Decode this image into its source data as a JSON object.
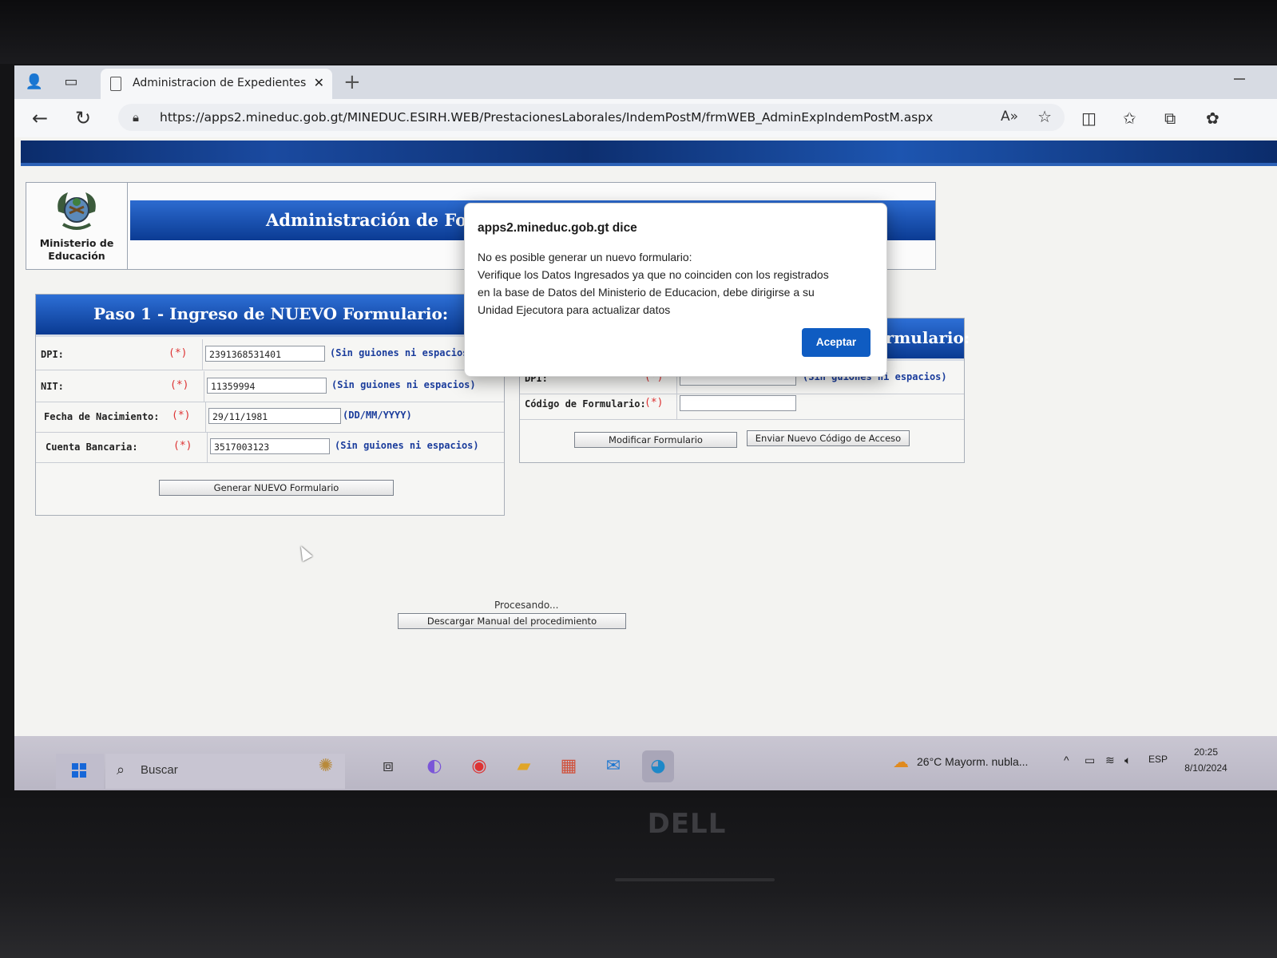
{
  "browser": {
    "tab_title": "Administracion de Expedientes de",
    "url": "https://apps2.mineduc.gob.gt/MINEDUC.ESIRH.WEB/PrestacionesLaborales/IndemPostM/frmWEB_AdminExpIndemPostM.aspx"
  },
  "header": {
    "logo_line1": "Ministerio de",
    "logo_line2": "Educación",
    "title": "Administración de Formularios"
  },
  "step1": {
    "title": "Paso 1 - Ingreso de NUEVO Formulario:",
    "required_mark": "(*)",
    "rows": [
      {
        "label": "DPI:",
        "value": "2391368531401",
        "hint": "(Sin guiones ni espacios)"
      },
      {
        "label": "NIT:",
        "value": "11359994",
        "hint": "(Sin guiones ni espacios)"
      },
      {
        "label": "Fecha de Nacimiento:",
        "value": "29/11/1981",
        "hint": "(DD/MM/YYYY)"
      },
      {
        "label": "Cuenta Bancaria:",
        "value": "3517003123",
        "hint": "(Sin guiones ni espacios)"
      }
    ],
    "button": "Generar NUEVO Formulario"
  },
  "step2": {
    "title": "Paso 2 - Modificación y Consulta de Formulario:",
    "required_mark": "(*)",
    "rows": [
      {
        "label": "DPI:",
        "value": "",
        "hint": "(Sin guiones ni espacios)"
      },
      {
        "label": "Código de Formulario:",
        "value": ""
      }
    ],
    "modify_button": "Modificar Formulario",
    "send_code_button": "Enviar Nuevo Código de Acceso"
  },
  "processing_text": "Procesando...",
  "manual_button": "Descargar Manual del procedimiento",
  "dialog": {
    "title": "apps2.mineduc.gob.gt dice",
    "lines": [
      "No es posible generar un nuevo formulario:",
      "Verifique los Datos Ingresados ya que no coinciden con los registrados",
      "en la base de Datos del Ministerio de Educacion, debe dirigirse a su",
      "Unidad Ejecutora para actualizar datos"
    ],
    "ok_label": "Aceptar"
  },
  "taskbar": {
    "search_placeholder": "Buscar",
    "weather": "26°C  Mayorm. nubla...",
    "language": "ESP",
    "time": "20:25",
    "date": "8/10/2024"
  },
  "device_brand": "DELL",
  "colors": {
    "header_blue": "#0b3b93",
    "dialog_button": "#0f5cc2",
    "required_red": "#dd3333",
    "hint_blue": "#1b3d9c"
  }
}
